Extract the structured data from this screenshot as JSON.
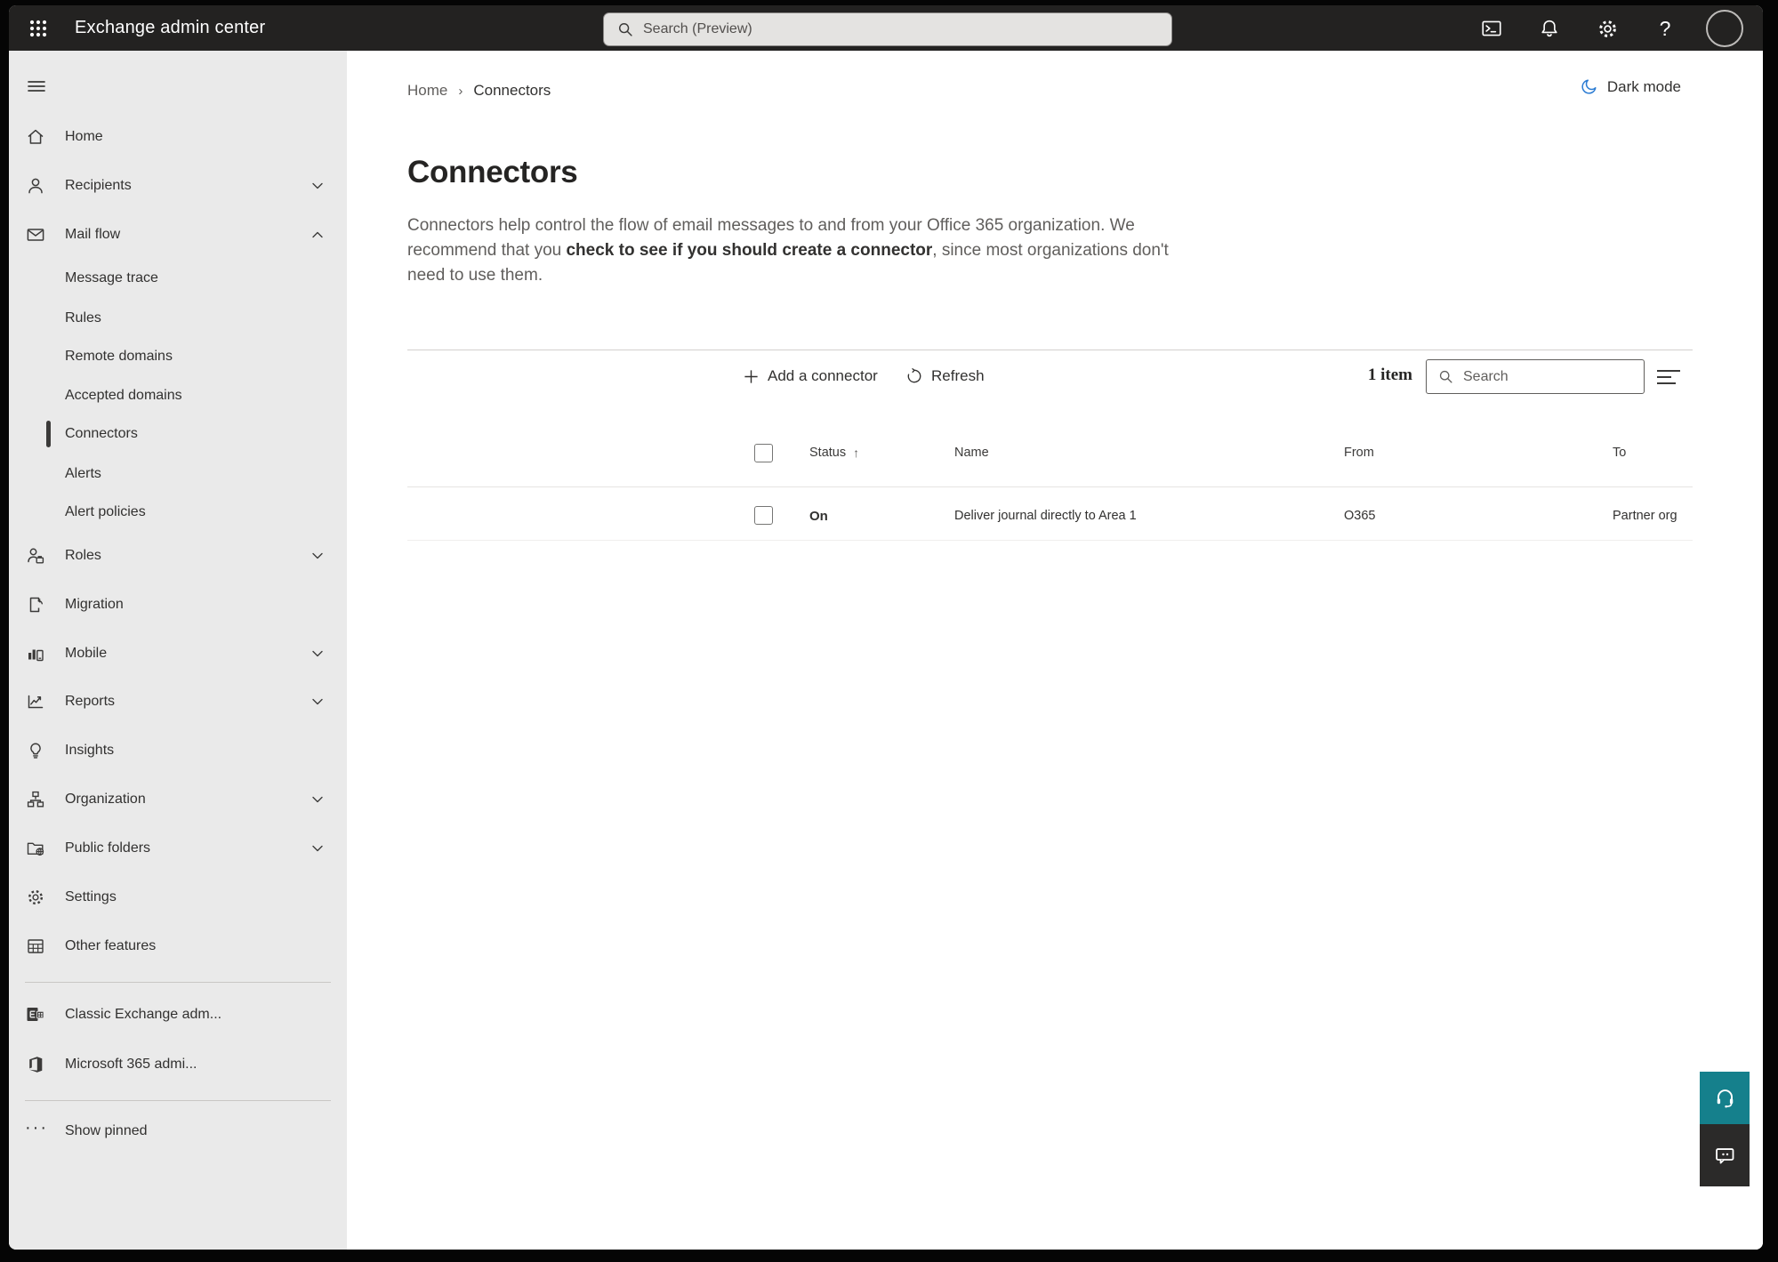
{
  "topbar": {
    "app_title": "Exchange admin center",
    "search_placeholder": "Search (Preview)"
  },
  "sidebar": {
    "items": [
      {
        "label": "Home"
      },
      {
        "label": "Recipients"
      },
      {
        "label": "Mail flow"
      },
      {
        "label": "Message trace"
      },
      {
        "label": "Rules"
      },
      {
        "label": "Remote domains"
      },
      {
        "label": "Accepted domains"
      },
      {
        "label": "Connectors"
      },
      {
        "label": "Alerts"
      },
      {
        "label": "Alert policies"
      },
      {
        "label": "Roles"
      },
      {
        "label": "Migration"
      },
      {
        "label": "Mobile"
      },
      {
        "label": "Reports"
      },
      {
        "label": "Insights"
      },
      {
        "label": "Organization"
      },
      {
        "label": "Public folders"
      },
      {
        "label": "Settings"
      },
      {
        "label": "Other features"
      },
      {
        "label": "Classic Exchange adm..."
      },
      {
        "label": "Microsoft 365 admi..."
      },
      {
        "label": "Show pinned"
      }
    ]
  },
  "breadcrumb": {
    "home": "Home",
    "current": "Connectors"
  },
  "dark_mode_label": "Dark mode",
  "page": {
    "title": "Connectors",
    "desc_line1": "Connectors help control the flow of email messages to and from your Office 365 organization. We",
    "desc_line2_pre": "recommend that you ",
    "desc_line2_bold": "check to see if you should create a connector",
    "desc_line2_post": ", since most organizations don't",
    "desc_line3": "need to use them."
  },
  "toolbar": {
    "add_label": "Add a connector",
    "refresh_label": "Refresh",
    "item_count": "1 item",
    "search_placeholder": "Search"
  },
  "table": {
    "columns": {
      "status": "Status",
      "name": "Name",
      "from": "From",
      "to": "To"
    },
    "rows": [
      {
        "status": "On",
        "name": "Deliver journal directly to Area 1",
        "from": "O365",
        "to": "Partner org"
      }
    ]
  },
  "colors": {
    "topbar_bg": "#232221",
    "sidebar_bg": "#eaeaea",
    "accent_moon_blue": "#2b7cd3",
    "support_teal": "#15808c",
    "feedback_dark": "#2b2a29",
    "text_primary": "#323130",
    "text_secondary": "#605e5c"
  }
}
